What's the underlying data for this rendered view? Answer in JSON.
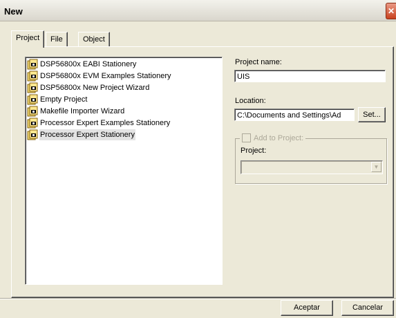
{
  "window": {
    "title": "New"
  },
  "tabs": [
    {
      "label": "Project"
    },
    {
      "label": "File"
    },
    {
      "label": "Object"
    }
  ],
  "stationery_list": [
    {
      "label": "DSP56800x EABI Stationery",
      "icon": "stationery-icon",
      "selected": false
    },
    {
      "label": "DSP56800x EVM Examples Stationery",
      "icon": "stationery-icon",
      "selected": false
    },
    {
      "label": "DSP56800x New Project Wizard",
      "icon": "stationery-icon",
      "selected": false
    },
    {
      "label": "Empty Project",
      "icon": "stationery-icon",
      "selected": false
    },
    {
      "label": "Makefile Importer Wizard",
      "icon": "stationery-icon",
      "selected": false
    },
    {
      "label": "Processor Expert Examples Stationery",
      "icon": "stationery-icon",
      "selected": false
    },
    {
      "label": "Processor Expert Stationery",
      "icon": "stationery-icon",
      "selected": true
    }
  ],
  "project_name": {
    "label": "Project name:",
    "value": "UIS"
  },
  "location": {
    "label": "Location:",
    "value": "C:\\Documents and Settings\\Ad",
    "set_button": "Set..."
  },
  "add_to_project": {
    "checkbox_label": "Add to Project:",
    "checked": false,
    "enabled": false,
    "project_label": "Project:",
    "project_value": ""
  },
  "buttons": {
    "ok": "Aceptar",
    "cancel": "Cancelar"
  },
  "colors": {
    "dialog_bg": "#ece9d8",
    "close_button": "#c8421f",
    "selection_bg": "#e3e3e3"
  }
}
